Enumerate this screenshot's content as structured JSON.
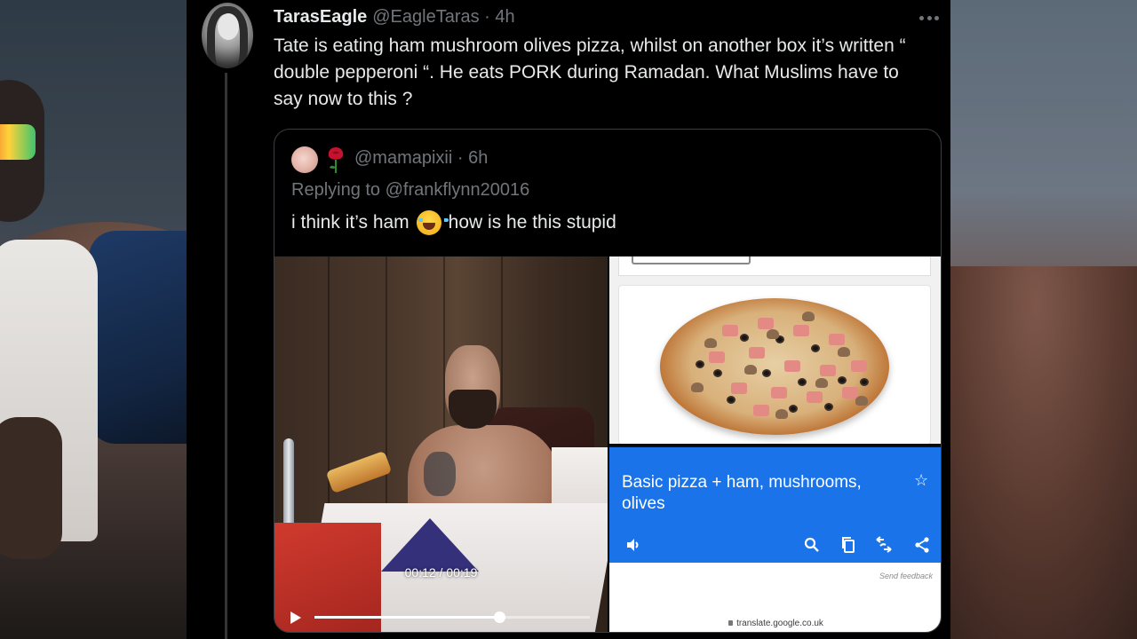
{
  "tweet": {
    "display_name": "TarasEagle",
    "handle_time": "@EagleTaras · 4h",
    "text": "Tate is eating ham mushroom olives pizza, whilst on another box it’s written “ double pepperoni “. He eats PORK during Ramadan. What Muslims have to say now to this ?"
  },
  "quote": {
    "handle_time": "@mamapixii · 6h",
    "replying_to": "Replying to @frankflynn20016",
    "text_before": "i think it’s ham",
    "text_after": "how is he this stupid"
  },
  "video": {
    "time": "00:12 / 00:19",
    "progress": 0.67
  },
  "translate": {
    "text": "Basic pizza + ham, mushrooms, olives",
    "feedback": "Send feedback",
    "url": "translate.google.co.uk",
    "accent": "#1a73e8"
  },
  "icons": [
    "more-icon",
    "rose-icon",
    "tears-of-joy-emoji-icon",
    "play-icon",
    "star-icon",
    "speaker-icon",
    "search-icon",
    "copy-icon",
    "swap-icon",
    "share-icon",
    "lock-icon"
  ]
}
